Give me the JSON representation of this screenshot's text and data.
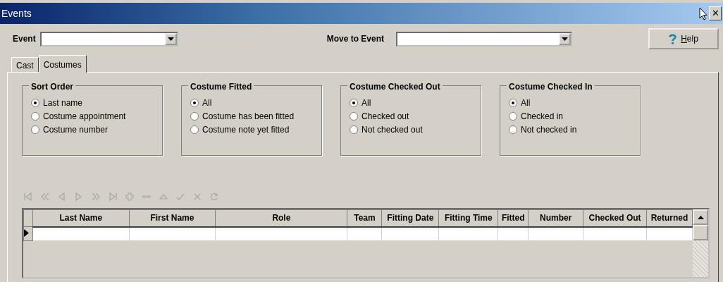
{
  "window": {
    "title": "Events",
    "close": "✕"
  },
  "event_field": {
    "label": "Event"
  },
  "move_field": {
    "label": "Move to Event"
  },
  "help_button": {
    "label": "Help",
    "first_letter_underlined": true
  },
  "tabs": [
    {
      "label": "Cast",
      "selected": false
    },
    {
      "label": "Costumes",
      "selected": true
    }
  ],
  "groups": [
    {
      "title": "Sort Order",
      "options": [
        {
          "label": "Last name",
          "selected": true
        },
        {
          "label": "Costume appointment",
          "selected": false
        },
        {
          "label": "Costume number",
          "selected": false
        }
      ]
    },
    {
      "title": "Costume Fitted",
      "options": [
        {
          "label": "All",
          "selected": true
        },
        {
          "label": "Costume has been fitted",
          "selected": false
        },
        {
          "label": "Costume note yet fitted",
          "selected": false
        }
      ]
    },
    {
      "title": "Costume Checked Out",
      "options": [
        {
          "label": "All",
          "selected": true
        },
        {
          "label": "Checked out",
          "selected": false
        },
        {
          "label": "Not checked out",
          "selected": false
        }
      ]
    },
    {
      "title": "Costume Checked In",
      "options": [
        {
          "label": "All",
          "selected": true
        },
        {
          "label": "Checked in",
          "selected": false
        },
        {
          "label": "Not checked in",
          "selected": false
        }
      ]
    }
  ],
  "navigator": {
    "disabled": true
  },
  "table": {
    "columns": [
      "Last Name",
      "First Name",
      "Role",
      "Team",
      "Fitting Date",
      "Fitting Time",
      "Fitted",
      "Number",
      "Checked Out",
      "Returned"
    ],
    "rows": [
      {
        "current": true
      }
    ]
  }
}
